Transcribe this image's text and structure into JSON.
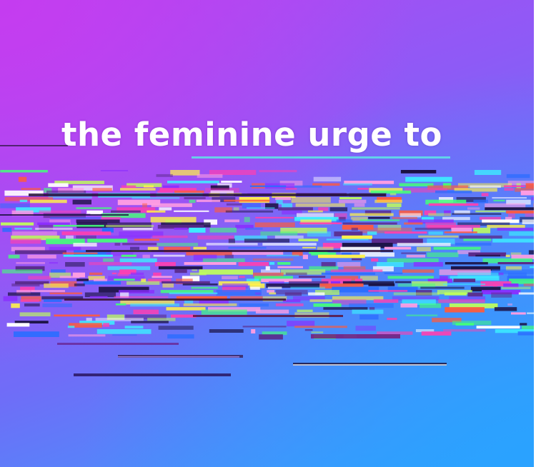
{
  "caption": {
    "text": "the feminine urge to"
  },
  "colors": {
    "gradient_top_left": "#c53cf0",
    "gradient_mid": "#7e63f7",
    "gradient_bottom_right": "#2aa5ff",
    "caption_text": "#ffffff"
  },
  "glitch": {
    "palette": [
      "#ff3fb0",
      "#3cf0ff",
      "#fff24a",
      "#44ff7a",
      "#ff5a3c",
      "#8a2cff",
      "#ffffff",
      "#1a1040",
      "#2b6cff",
      "#ff9de2",
      "#c0ff5a",
      "#5a2a8a"
    ]
  }
}
